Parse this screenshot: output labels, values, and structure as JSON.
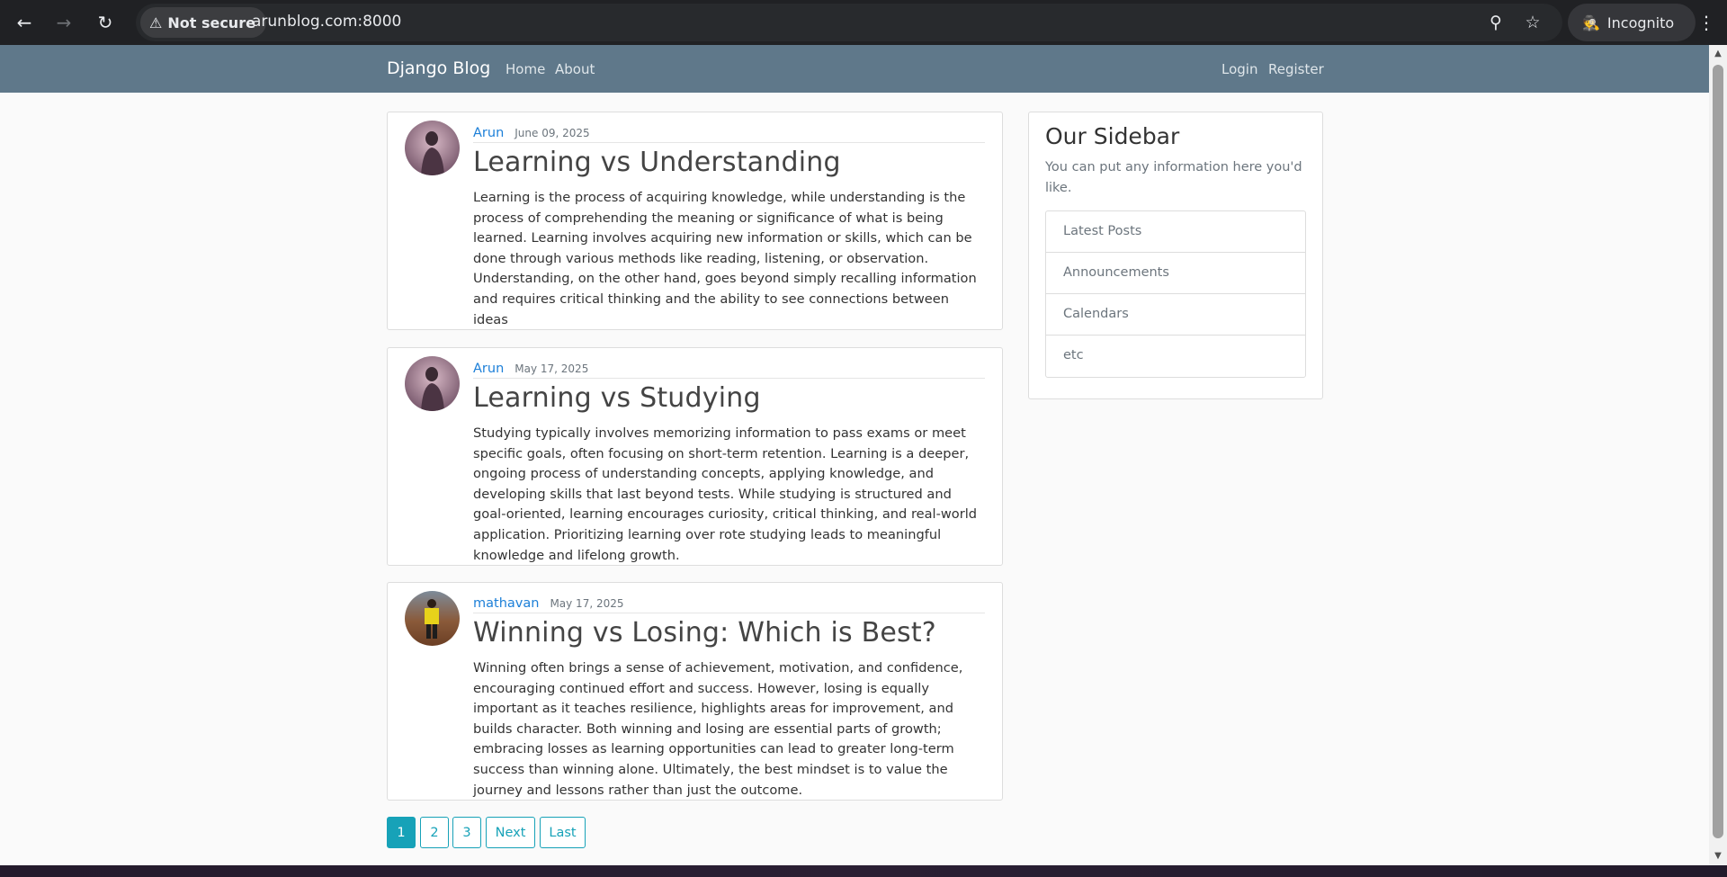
{
  "browser": {
    "security_label": "Not secure",
    "url": "arunblog.com:8000",
    "profile_label": "Incognito"
  },
  "site": {
    "brand": "Django Blog",
    "nav_left": [
      "Home",
      "About"
    ],
    "nav_right": [
      "Login",
      "Register"
    ]
  },
  "posts": [
    {
      "author": "Arun",
      "date": "June 09, 2025",
      "title": "Learning vs Understanding",
      "body": "Learning is the process of acquiring knowledge, while understanding is the process of comprehending the meaning or significance of what is being learned. Learning involves acquiring new information or skills, which can be done through various methods like reading, listening, or observation. Understanding, on the other hand, goes beyond simply recalling information and requires critical thinking and the ability to see connections between ideas"
    },
    {
      "author": "Arun",
      "date": "May 17, 2025",
      "title": "Learning vs Studying",
      "body": "Studying typically involves memorizing information to pass exams or meet specific goals, often focusing on short-term retention. Learning is a deeper, ongoing process of understanding concepts, applying knowledge, and developing skills that last beyond tests. While studying is structured and goal-oriented, learning encourages curiosity, critical thinking, and real-world application. Prioritizing learning over rote studying leads to meaningful knowledge and lifelong growth."
    },
    {
      "author": "mathavan",
      "date": "May 17, 2025",
      "title": "Winning vs Losing: Which is Best?",
      "body": "Winning often brings a sense of achievement, motivation, and confidence, encouraging continued effort and success. However, losing is equally important as it teaches resilience, highlights areas for improvement, and builds character. Both winning and losing are essential parts of growth; embracing losses as learning opportunities can lead to greater long-term success than winning alone. Ultimately, the best mindset is to value the journey and lessons rather than just the outcome."
    }
  ],
  "sidebar": {
    "title": "Our Sidebar",
    "description": "You can put any information here you'd like.",
    "items": [
      "Latest Posts",
      "Announcements",
      "Calendars",
      "etc"
    ]
  },
  "pagination": {
    "pages": [
      "1",
      "2",
      "3"
    ],
    "next_label": "Next",
    "last_label": "Last",
    "current": "1"
  },
  "colors": {
    "navbar": "#5f788a",
    "author_link": "#1c7fd8",
    "pager_accent": "#17a2b8"
  }
}
